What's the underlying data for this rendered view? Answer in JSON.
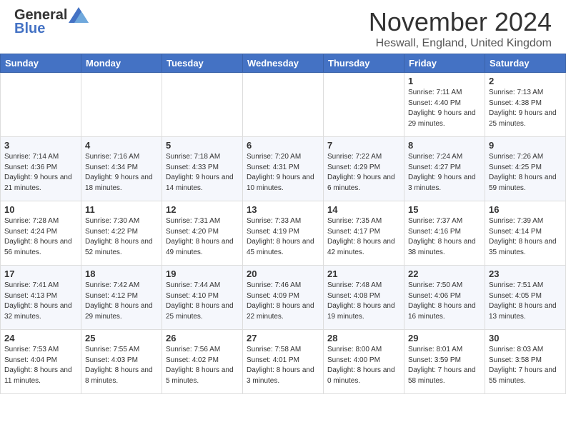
{
  "header": {
    "logo_general": "General",
    "logo_blue": "Blue",
    "title": "November 2024",
    "subtitle": "Heswall, England, United Kingdom"
  },
  "days_of_week": [
    "Sunday",
    "Monday",
    "Tuesday",
    "Wednesday",
    "Thursday",
    "Friday",
    "Saturday"
  ],
  "weeks": [
    [
      {
        "day": "",
        "info": ""
      },
      {
        "day": "",
        "info": ""
      },
      {
        "day": "",
        "info": ""
      },
      {
        "day": "",
        "info": ""
      },
      {
        "day": "",
        "info": ""
      },
      {
        "day": "1",
        "info": "Sunrise: 7:11 AM\nSunset: 4:40 PM\nDaylight: 9 hours and 29 minutes."
      },
      {
        "day": "2",
        "info": "Sunrise: 7:13 AM\nSunset: 4:38 PM\nDaylight: 9 hours and 25 minutes."
      }
    ],
    [
      {
        "day": "3",
        "info": "Sunrise: 7:14 AM\nSunset: 4:36 PM\nDaylight: 9 hours and 21 minutes."
      },
      {
        "day": "4",
        "info": "Sunrise: 7:16 AM\nSunset: 4:34 PM\nDaylight: 9 hours and 18 minutes."
      },
      {
        "day": "5",
        "info": "Sunrise: 7:18 AM\nSunset: 4:33 PM\nDaylight: 9 hours and 14 minutes."
      },
      {
        "day": "6",
        "info": "Sunrise: 7:20 AM\nSunset: 4:31 PM\nDaylight: 9 hours and 10 minutes."
      },
      {
        "day": "7",
        "info": "Sunrise: 7:22 AM\nSunset: 4:29 PM\nDaylight: 9 hours and 6 minutes."
      },
      {
        "day": "8",
        "info": "Sunrise: 7:24 AM\nSunset: 4:27 PM\nDaylight: 9 hours and 3 minutes."
      },
      {
        "day": "9",
        "info": "Sunrise: 7:26 AM\nSunset: 4:25 PM\nDaylight: 8 hours and 59 minutes."
      }
    ],
    [
      {
        "day": "10",
        "info": "Sunrise: 7:28 AM\nSunset: 4:24 PM\nDaylight: 8 hours and 56 minutes."
      },
      {
        "day": "11",
        "info": "Sunrise: 7:30 AM\nSunset: 4:22 PM\nDaylight: 8 hours and 52 minutes."
      },
      {
        "day": "12",
        "info": "Sunrise: 7:31 AM\nSunset: 4:20 PM\nDaylight: 8 hours and 49 minutes."
      },
      {
        "day": "13",
        "info": "Sunrise: 7:33 AM\nSunset: 4:19 PM\nDaylight: 8 hours and 45 minutes."
      },
      {
        "day": "14",
        "info": "Sunrise: 7:35 AM\nSunset: 4:17 PM\nDaylight: 8 hours and 42 minutes."
      },
      {
        "day": "15",
        "info": "Sunrise: 7:37 AM\nSunset: 4:16 PM\nDaylight: 8 hours and 38 minutes."
      },
      {
        "day": "16",
        "info": "Sunrise: 7:39 AM\nSunset: 4:14 PM\nDaylight: 8 hours and 35 minutes."
      }
    ],
    [
      {
        "day": "17",
        "info": "Sunrise: 7:41 AM\nSunset: 4:13 PM\nDaylight: 8 hours and 32 minutes."
      },
      {
        "day": "18",
        "info": "Sunrise: 7:42 AM\nSunset: 4:12 PM\nDaylight: 8 hours and 29 minutes."
      },
      {
        "day": "19",
        "info": "Sunrise: 7:44 AM\nSunset: 4:10 PM\nDaylight: 8 hours and 25 minutes."
      },
      {
        "day": "20",
        "info": "Sunrise: 7:46 AM\nSunset: 4:09 PM\nDaylight: 8 hours and 22 minutes."
      },
      {
        "day": "21",
        "info": "Sunrise: 7:48 AM\nSunset: 4:08 PM\nDaylight: 8 hours and 19 minutes."
      },
      {
        "day": "22",
        "info": "Sunrise: 7:50 AM\nSunset: 4:06 PM\nDaylight: 8 hours and 16 minutes."
      },
      {
        "day": "23",
        "info": "Sunrise: 7:51 AM\nSunset: 4:05 PM\nDaylight: 8 hours and 13 minutes."
      }
    ],
    [
      {
        "day": "24",
        "info": "Sunrise: 7:53 AM\nSunset: 4:04 PM\nDaylight: 8 hours and 11 minutes."
      },
      {
        "day": "25",
        "info": "Sunrise: 7:55 AM\nSunset: 4:03 PM\nDaylight: 8 hours and 8 minutes."
      },
      {
        "day": "26",
        "info": "Sunrise: 7:56 AM\nSunset: 4:02 PM\nDaylight: 8 hours and 5 minutes."
      },
      {
        "day": "27",
        "info": "Sunrise: 7:58 AM\nSunset: 4:01 PM\nDaylight: 8 hours and 3 minutes."
      },
      {
        "day": "28",
        "info": "Sunrise: 8:00 AM\nSunset: 4:00 PM\nDaylight: 8 hours and 0 minutes."
      },
      {
        "day": "29",
        "info": "Sunrise: 8:01 AM\nSunset: 3:59 PM\nDaylight: 7 hours and 58 minutes."
      },
      {
        "day": "30",
        "info": "Sunrise: 8:03 AM\nSunset: 3:58 PM\nDaylight: 7 hours and 55 minutes."
      }
    ]
  ]
}
